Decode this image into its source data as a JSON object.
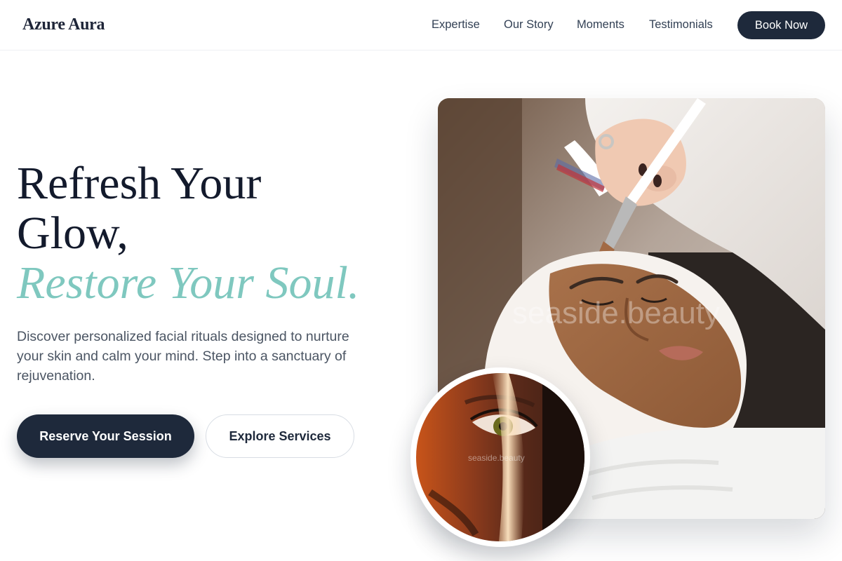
{
  "brand": {
    "name": "Azure Aura"
  },
  "nav": {
    "links": [
      "Expertise",
      "Our Story",
      "Moments",
      "Testimonials"
    ],
    "cta": "Book Now"
  },
  "hero": {
    "headline_line1": "Refresh Your",
    "headline_line2": "Glow,",
    "headline_accent": "Restore Your Soul.",
    "description": "Discover personalized facial rituals designed to nurture your skin and calm your mind. Step into a sanctuary of rejuvenation.",
    "primary_cta": "Reserve Your Session",
    "secondary_cta": "Explore Services"
  },
  "images": {
    "main_watermark": "seaside.beauty",
    "inset_watermark": "seaside.beauty"
  },
  "colors": {
    "primary": "#1e293b",
    "accent": "#7fc8bf",
    "heading": "#131a2c",
    "body_text": "#4b5563"
  }
}
